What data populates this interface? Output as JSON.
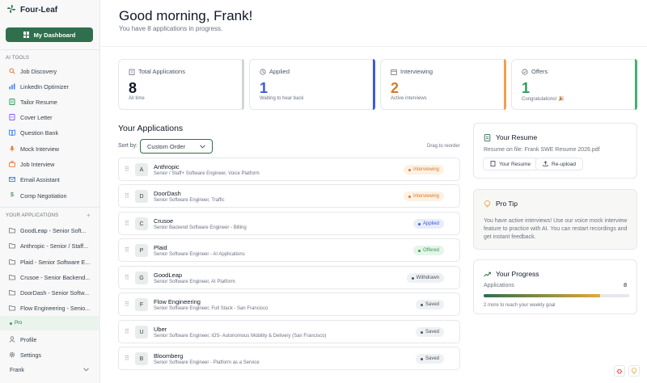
{
  "brand": {
    "name": "Four-Leaf"
  },
  "sidebar": {
    "dashboard_label": "My Dashboard",
    "ai_tools_label": "AI TOOLS",
    "ai_tools": [
      {
        "label": "Job Discovery",
        "icon": "search-icon",
        "color": "#e07a3a"
      },
      {
        "label": "LinkedIn Optimizer",
        "icon": "bar-chart-icon",
        "color": "#3b82f6"
      },
      {
        "label": "Tailor Resume",
        "icon": "document-icon",
        "color": "#2f9e5a"
      },
      {
        "label": "Cover Letter",
        "icon": "pen-icon",
        "color": "#8b5cf6"
      },
      {
        "label": "Question Bank",
        "icon": "book-icon",
        "color": "#3b82f6"
      },
      {
        "label": "Mock Interview",
        "icon": "mic-icon",
        "color": "#e07a3a"
      },
      {
        "label": "Job Interview",
        "icon": "briefcase-icon",
        "color": "#e07a3a"
      },
      {
        "label": "Email Assistant",
        "icon": "mail-icon",
        "color": "#3b82f6"
      },
      {
        "label": "Comp Negotiation",
        "icon": "dollar-icon",
        "color": "#2f6f4e"
      }
    ],
    "your_apps_label": "YOUR APPLICATIONS",
    "your_apps": [
      {
        "label": "GoodLeap - Senior Soft..."
      },
      {
        "label": "Anthropic - Senior / Staff..."
      },
      {
        "label": "Plaid - Senior Software E..."
      },
      {
        "label": "Crusoe - Senior Backend..."
      },
      {
        "label": "DoorDash - Senior Softw..."
      },
      {
        "label": "Flow Engineering - Senio..."
      }
    ],
    "pro_label": "Pro",
    "profile_label": "Profile",
    "settings_label": "Settings",
    "user_name": "Frank"
  },
  "header": {
    "greeting": "Good morning, Frank!",
    "subtitle": "You have 8 applications in progress."
  },
  "stats": [
    {
      "label": "Total Applications",
      "value": "8",
      "desc": "All time",
      "color": "#111827",
      "accent": "#d1d5db",
      "icon": "building-icon"
    },
    {
      "label": "Applied",
      "value": "1",
      "desc": "Waiting to hear back",
      "color": "#3b5bdb",
      "accent": "#3b5bdb",
      "icon": "clock-icon"
    },
    {
      "label": "Interviewing",
      "value": "2",
      "desc": "Active interviews",
      "color": "#d97a2b",
      "accent": "#f0a04b",
      "icon": "calendar-icon"
    },
    {
      "label": "Offers",
      "value": "1",
      "desc": "Congratulations! 🎉",
      "color": "#2f9e5a",
      "accent": "#3fb36b",
      "icon": "check-circle-icon"
    }
  ],
  "applications": {
    "title": "Your Applications",
    "sort_label": "Sort by:",
    "sort_value": "Custom Order",
    "drag_hint": "Drag to reorder",
    "rows": [
      {
        "initial": "A",
        "company": "Anthropic",
        "role": "Senior / Staff+ Software Engineer, Voice Platform",
        "status": "Interviewing",
        "status_color": "#d97a2b",
        "status_bg": "#fdf1e4"
      },
      {
        "initial": "D",
        "company": "DoorDash",
        "role": "Senior Software Engineer, Traffic",
        "status": "Interviewing",
        "status_color": "#d97a2b",
        "status_bg": "#fdf1e4"
      },
      {
        "initial": "C",
        "company": "Crusoe",
        "role": "Senior Backend Software Engineer - Billing",
        "status": "Applied",
        "status_color": "#3b5bdb",
        "status_bg": "#e8edfb"
      },
      {
        "initial": "P",
        "company": "Plaid",
        "role": "Senior Software Engineer - AI Applications",
        "status": "Offered",
        "status_color": "#2f9e5a",
        "status_bg": "#e6f4ea"
      },
      {
        "initial": "G",
        "company": "GoodLeap",
        "role": "Senior Software Engineer, AI Platform",
        "status": "Withdrawn",
        "status_color": "#4b5563",
        "status_bg": "#eef0f2"
      },
      {
        "initial": "F",
        "company": "Flow Engineering",
        "role": "Senior Software Engineer, Full Stack - San Francisco",
        "status": "Saved",
        "status_color": "#4b5563",
        "status_bg": "#eef0f2"
      },
      {
        "initial": "U",
        "company": "Uber",
        "role": "Senior Software Engineer, iOS- Autonomous Mobility & Delivery (San Francisco)",
        "status": "Saved",
        "status_color": "#4b5563",
        "status_bg": "#eef0f2"
      },
      {
        "initial": "B",
        "company": "Bloomberg",
        "role": "Senior Software Engineer - Platform as a Service",
        "status": "Saved",
        "status_color": "#4b5563",
        "status_bg": "#eef0f2"
      }
    ]
  },
  "resume_card": {
    "title": "Your Resume",
    "file_text": "Resume on file: Frank SWE Resume 2026.pdf",
    "your_resume_btn": "Your Resume",
    "reupload_btn": "Re-upload"
  },
  "pro_tip": {
    "title": "Pro Tip",
    "text": "You have active interviews! Use our voice mock interview feature to practice with AI. You can restart recordings and get instant feedback."
  },
  "progress": {
    "title": "Your Progress",
    "label": "Applications",
    "value": "8",
    "fraction": 0.8,
    "note": "2 more to reach your weekly goal"
  }
}
